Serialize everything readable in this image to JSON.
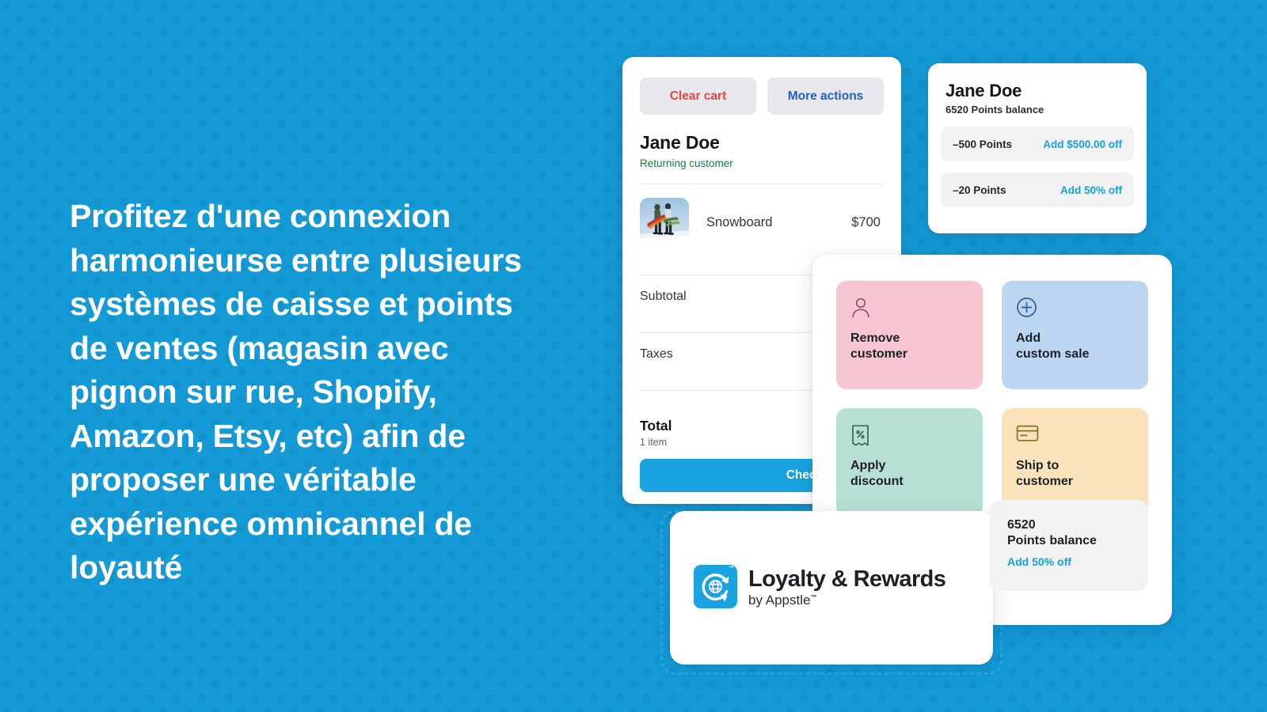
{
  "background": {
    "color": "#149ad7",
    "dot_color": "rgba(0,0,0,0.055)"
  },
  "headline": {
    "text": "Profitez d'une connexion harmonieurse entre plusieurs systèmes de caisse et points de ventes (magasin avec pignon sur rue, Shopify, Amazon, Etsy, etc) afin de proposer une véritable expérience omnicannel de loyauté",
    "color": "#ffffff"
  },
  "cart_card": {
    "clear_cart_label": "Clear cart",
    "clear_cart_color": "#e8473f",
    "more_actions_label": "More actions",
    "more_actions_color": "#2160c4",
    "customer_name": "Jane Doe",
    "customer_status": "Returning customer",
    "customer_status_color": "#1a7a3c",
    "line_item": {
      "name": "Snowboard",
      "price": "$700",
      "thumbnail_icon": "snowboarders-photo"
    },
    "subtotal_label": "Subtotal",
    "taxes_label": "Taxes",
    "total_label": "Total",
    "item_count": "1 item",
    "checkout_label": "Checkout",
    "checkout_color": "#1aa3e0"
  },
  "points_card": {
    "name": "Jane Doe",
    "balance": "6520 Points balance",
    "rows": [
      {
        "cost": "–500 Points",
        "reward": "Add $500.00 off"
      },
      {
        "cost": "–20 Points",
        "reward": "Add 50% off"
      }
    ],
    "reward_color": "#1a9fdc"
  },
  "actions_panel": {
    "tiles": [
      {
        "label": "Remove\ncustomer",
        "icon": "person-icon",
        "bg": "#f5c6d2",
        "icon_color": "#9b4d68"
      },
      {
        "label": "Add\ncustom sale",
        "icon": "plus-circle-icon",
        "bg": "#bcd6f2",
        "icon_color": "#2f5f9e"
      },
      {
        "label": "Apply\ndiscount",
        "icon": "discount-tag-icon",
        "bg": "#b9e0d4",
        "icon_color": "#2d6b59"
      },
      {
        "label": "Ship to\ncustomer",
        "icon": "credit-card-icon",
        "bg": "#fae3bb",
        "icon_color": "#8a6a2a"
      }
    ]
  },
  "balance_tile": {
    "points": "6520",
    "label": "Points balance",
    "action": "Add  50% off",
    "action_color": "#1a9fdc"
  },
  "loyalty_card": {
    "title": "Loyalty & Rewards",
    "subtitle": "by Appstle",
    "trademark": "™",
    "logo_icon": "globe-refresh-logo",
    "logo_bg": "#1aa3e0"
  },
  "selection": {
    "dash_color": "#1fa8e8"
  }
}
